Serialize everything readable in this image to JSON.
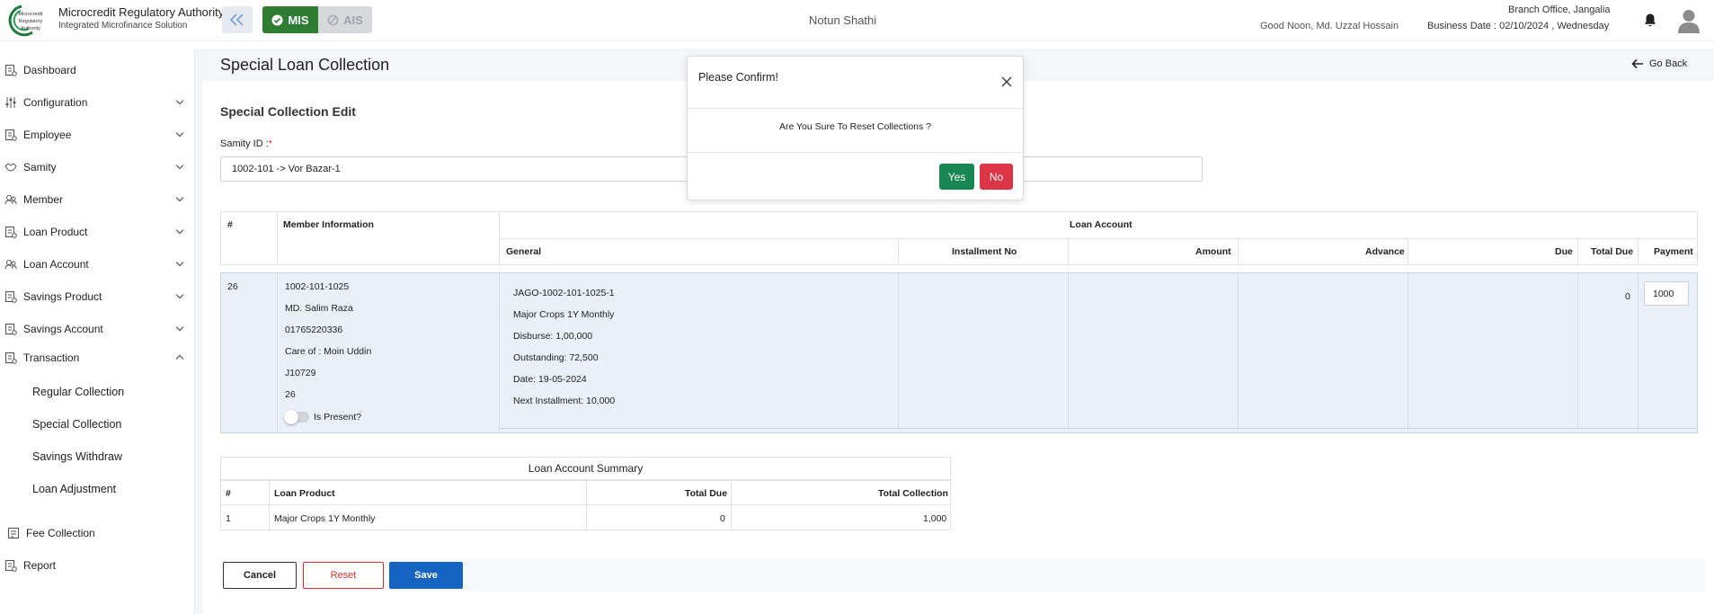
{
  "header": {
    "brand_title": "Microcredit Regulatory Authority",
    "brand_subtitle": "Integrated Microfinance Solution",
    "logo_text": [
      "Microcredit",
      "Regulatory",
      "Authority"
    ],
    "mis_label": "MIS",
    "ais_label": "AIS",
    "center_title": "Notun Shathi",
    "greeting": "Good Noon, Md. Uzzal Hossain",
    "branch": "Branch Office, Jangalia",
    "business_date": "Business Date : 02/10/2024 , Wednesday"
  },
  "sidebar": {
    "items": [
      {
        "label": "Dashboard",
        "icon": "dashboard-icon"
      },
      {
        "label": "Configuration",
        "icon": "sliders-icon"
      },
      {
        "label": "Employee",
        "icon": "employee-icon"
      },
      {
        "label": "Samity",
        "icon": "handshake-icon"
      },
      {
        "label": "Member",
        "icon": "member-icon"
      },
      {
        "label": "Loan Product",
        "icon": "document-icon"
      },
      {
        "label": "Loan Account",
        "icon": "member-icon"
      },
      {
        "label": "Savings Product",
        "icon": "document-icon"
      },
      {
        "label": "Savings Account",
        "icon": "document-icon"
      },
      {
        "label": "Transaction",
        "icon": "document-icon"
      },
      {
        "label": "Fee Collection",
        "icon": "fee-icon"
      },
      {
        "label": "Report",
        "icon": "document-icon"
      }
    ],
    "transaction_sub": [
      "Regular Collection",
      "Special Collection",
      "Savings Withdraw",
      "Loan Adjustment"
    ]
  },
  "page": {
    "title": "Special Loan Collection",
    "go_back": "Go Back",
    "section_title": "Special Collection Edit",
    "samity_label": "Samity ID :",
    "samity_required": "*",
    "samity_value": "1002-101 -> Vor Bazar-1"
  },
  "table": {
    "headers": {
      "hash": "#",
      "member_info": "Member Information",
      "loan_account": "Loan Account",
      "general": "General",
      "installment_no": "Installment No",
      "amount": "Amount",
      "advance": "Advance",
      "due": "Due",
      "total_due": "Total Due",
      "payment": "Payment"
    },
    "row": {
      "index": "26",
      "member_lines": [
        "1002-101-1025",
        "MD. Salim Raza",
        "01765220336",
        "Care of : Moin Uddin",
        "J10729",
        "26"
      ],
      "is_present_label": "Is Present?",
      "general_lines": [
        "JAGO-1002-101-1025-1",
        "Major Crops 1Y Monthly",
        "Disburse: 1,00,000",
        "Outstanding: 72,500",
        "Date: 19-05-2024",
        "Next Installment: 10,000"
      ],
      "total_due": "0",
      "payment": "1000"
    }
  },
  "summary": {
    "title": "Loan Account Summary",
    "headers": {
      "hash": "#",
      "loan_product": "Loan Product",
      "total_due": "Total Due",
      "total_collection": "Total Collection"
    },
    "row": {
      "hash": "1",
      "loan_product": "Major Crops 1Y Monthly",
      "total_due": "0",
      "total_collection": "1,000"
    }
  },
  "buttons": {
    "cancel": "Cancel",
    "reset": "Reset",
    "save": "Save"
  },
  "modal": {
    "title": "Please Confirm!",
    "message": "Are You Sure To Reset Collections ?",
    "yes": "Yes",
    "no": "No"
  },
  "colors": {
    "mis_green": "#2e7d32",
    "save_blue": "#1565c0",
    "reset_red": "#d32f2f",
    "yes_green": "#198754",
    "no_red": "#dc3545"
  }
}
